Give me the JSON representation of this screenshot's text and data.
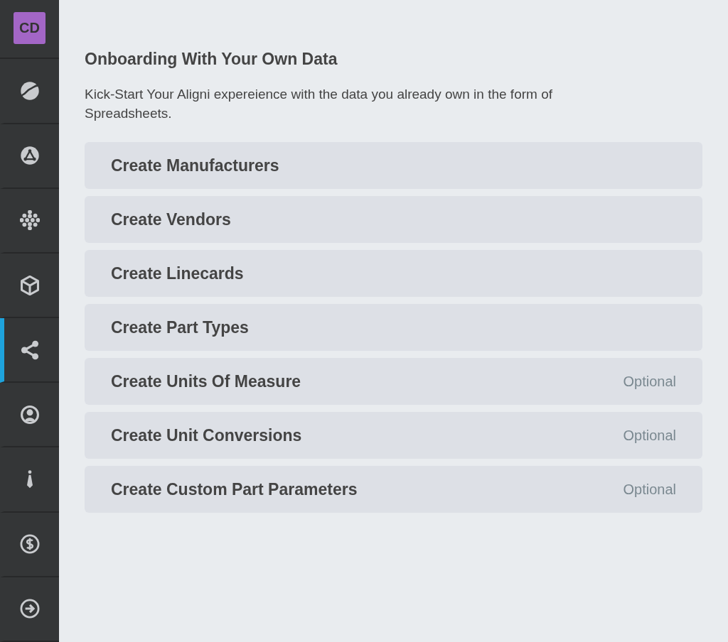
{
  "sidebar": {
    "avatar": {
      "initials": "CD"
    },
    "items": [
      {
        "selected": false
      },
      {
        "selected": false
      },
      {
        "selected": false
      },
      {
        "selected": false
      },
      {
        "selected": true
      },
      {
        "selected": false
      },
      {
        "selected": false
      },
      {
        "selected": false
      },
      {
        "selected": false
      }
    ]
  },
  "main": {
    "title": "Onboarding With Your Own Data",
    "description": "Kick-Start Your Aligni expereience with the data you already own in the form of Spreadsheets.",
    "steps": [
      {
        "label": "Create Manufacturers"
      },
      {
        "label": "Create Vendors"
      },
      {
        "label": "Create Linecards"
      },
      {
        "label": "Create Part Types"
      },
      {
        "label": "Create Units Of Measure",
        "badge": "Optional"
      },
      {
        "label": "Create Unit Conversions",
        "badge": "Optional"
      },
      {
        "label": "Create Custom Part Parameters",
        "badge": "Optional"
      }
    ]
  }
}
